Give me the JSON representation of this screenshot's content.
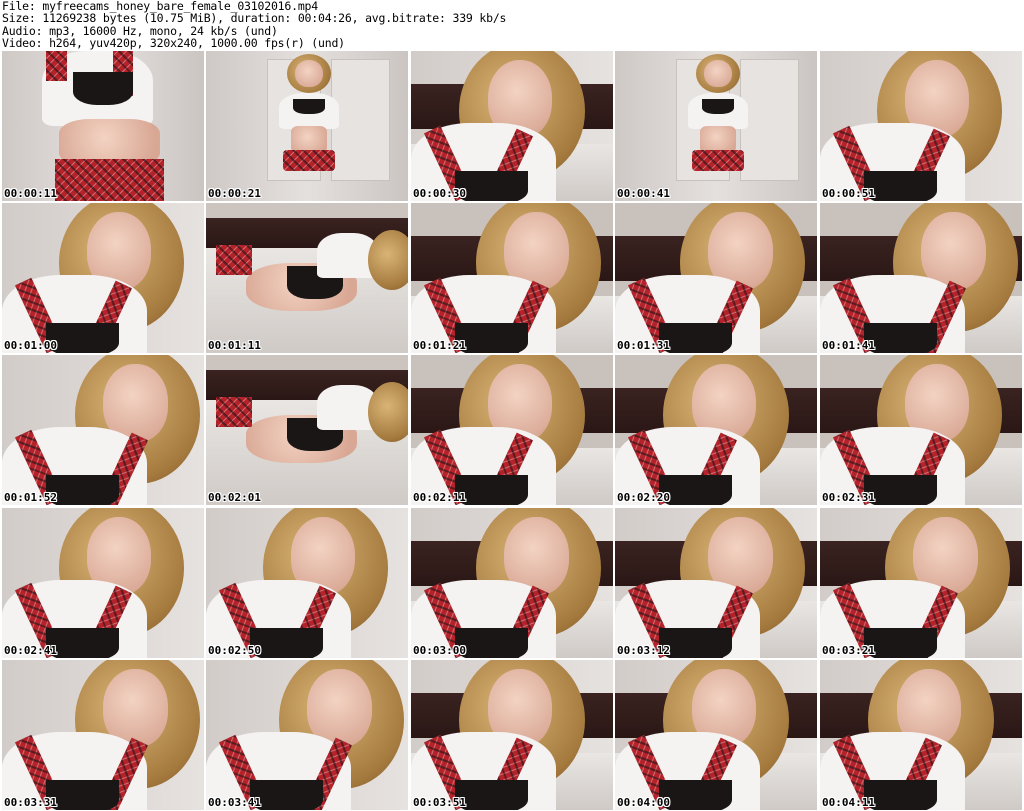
{
  "header": {
    "file_line": "File: myfreecams_honey_bare_female_03102016.mp4",
    "size_line": "Size: 11269238 bytes (10.75 MiB), duration: 00:04:26, avg.bitrate: 339 kb/s",
    "audio_line": "Audio: mp3, 16000 Hz, mono, 24 kb/s (und)",
    "video_line": "Video: h264, yuv420p, 320x240, 1000.00 fps(r) (und)"
  },
  "thumbnails": [
    {
      "time": "00:00:11",
      "scene": "standing"
    },
    {
      "time": "00:00:21",
      "scene": "standing-far"
    },
    {
      "time": "00:00:30",
      "scene": "closeup"
    },
    {
      "time": "00:00:41",
      "scene": "standing-far"
    },
    {
      "time": "00:00:51",
      "scene": "closeup"
    },
    {
      "time": "00:01:00",
      "scene": "closeup"
    },
    {
      "time": "00:01:11",
      "scene": "lying"
    },
    {
      "time": "00:01:21",
      "scene": "bed"
    },
    {
      "time": "00:01:31",
      "scene": "bed"
    },
    {
      "time": "00:01:41",
      "scene": "bed"
    },
    {
      "time": "00:01:52",
      "scene": "closeup"
    },
    {
      "time": "00:02:01",
      "scene": "lying"
    },
    {
      "time": "00:02:11",
      "scene": "bed"
    },
    {
      "time": "00:02:20",
      "scene": "bed"
    },
    {
      "time": "00:02:31",
      "scene": "bed"
    },
    {
      "time": "00:02:41",
      "scene": "closeup"
    },
    {
      "time": "00:02:50",
      "scene": "closeup"
    },
    {
      "time": "00:03:00",
      "scene": "closeup"
    },
    {
      "time": "00:03:12",
      "scene": "closeup"
    },
    {
      "time": "00:03:21",
      "scene": "closeup"
    },
    {
      "time": "00:03:31",
      "scene": "closeup"
    },
    {
      "time": "00:03:41",
      "scene": "closeup"
    },
    {
      "time": "00:03:51",
      "scene": "closeup"
    },
    {
      "time": "00:04:00",
      "scene": "closeup"
    },
    {
      "time": "00:04:11",
      "scene": "closeup"
    }
  ],
  "colors": {
    "background": "#ffffff",
    "plaid": "#b5222a",
    "shirt": "#f4f3f2",
    "hair": "#c9a05c",
    "headboard": "#3a2320"
  }
}
